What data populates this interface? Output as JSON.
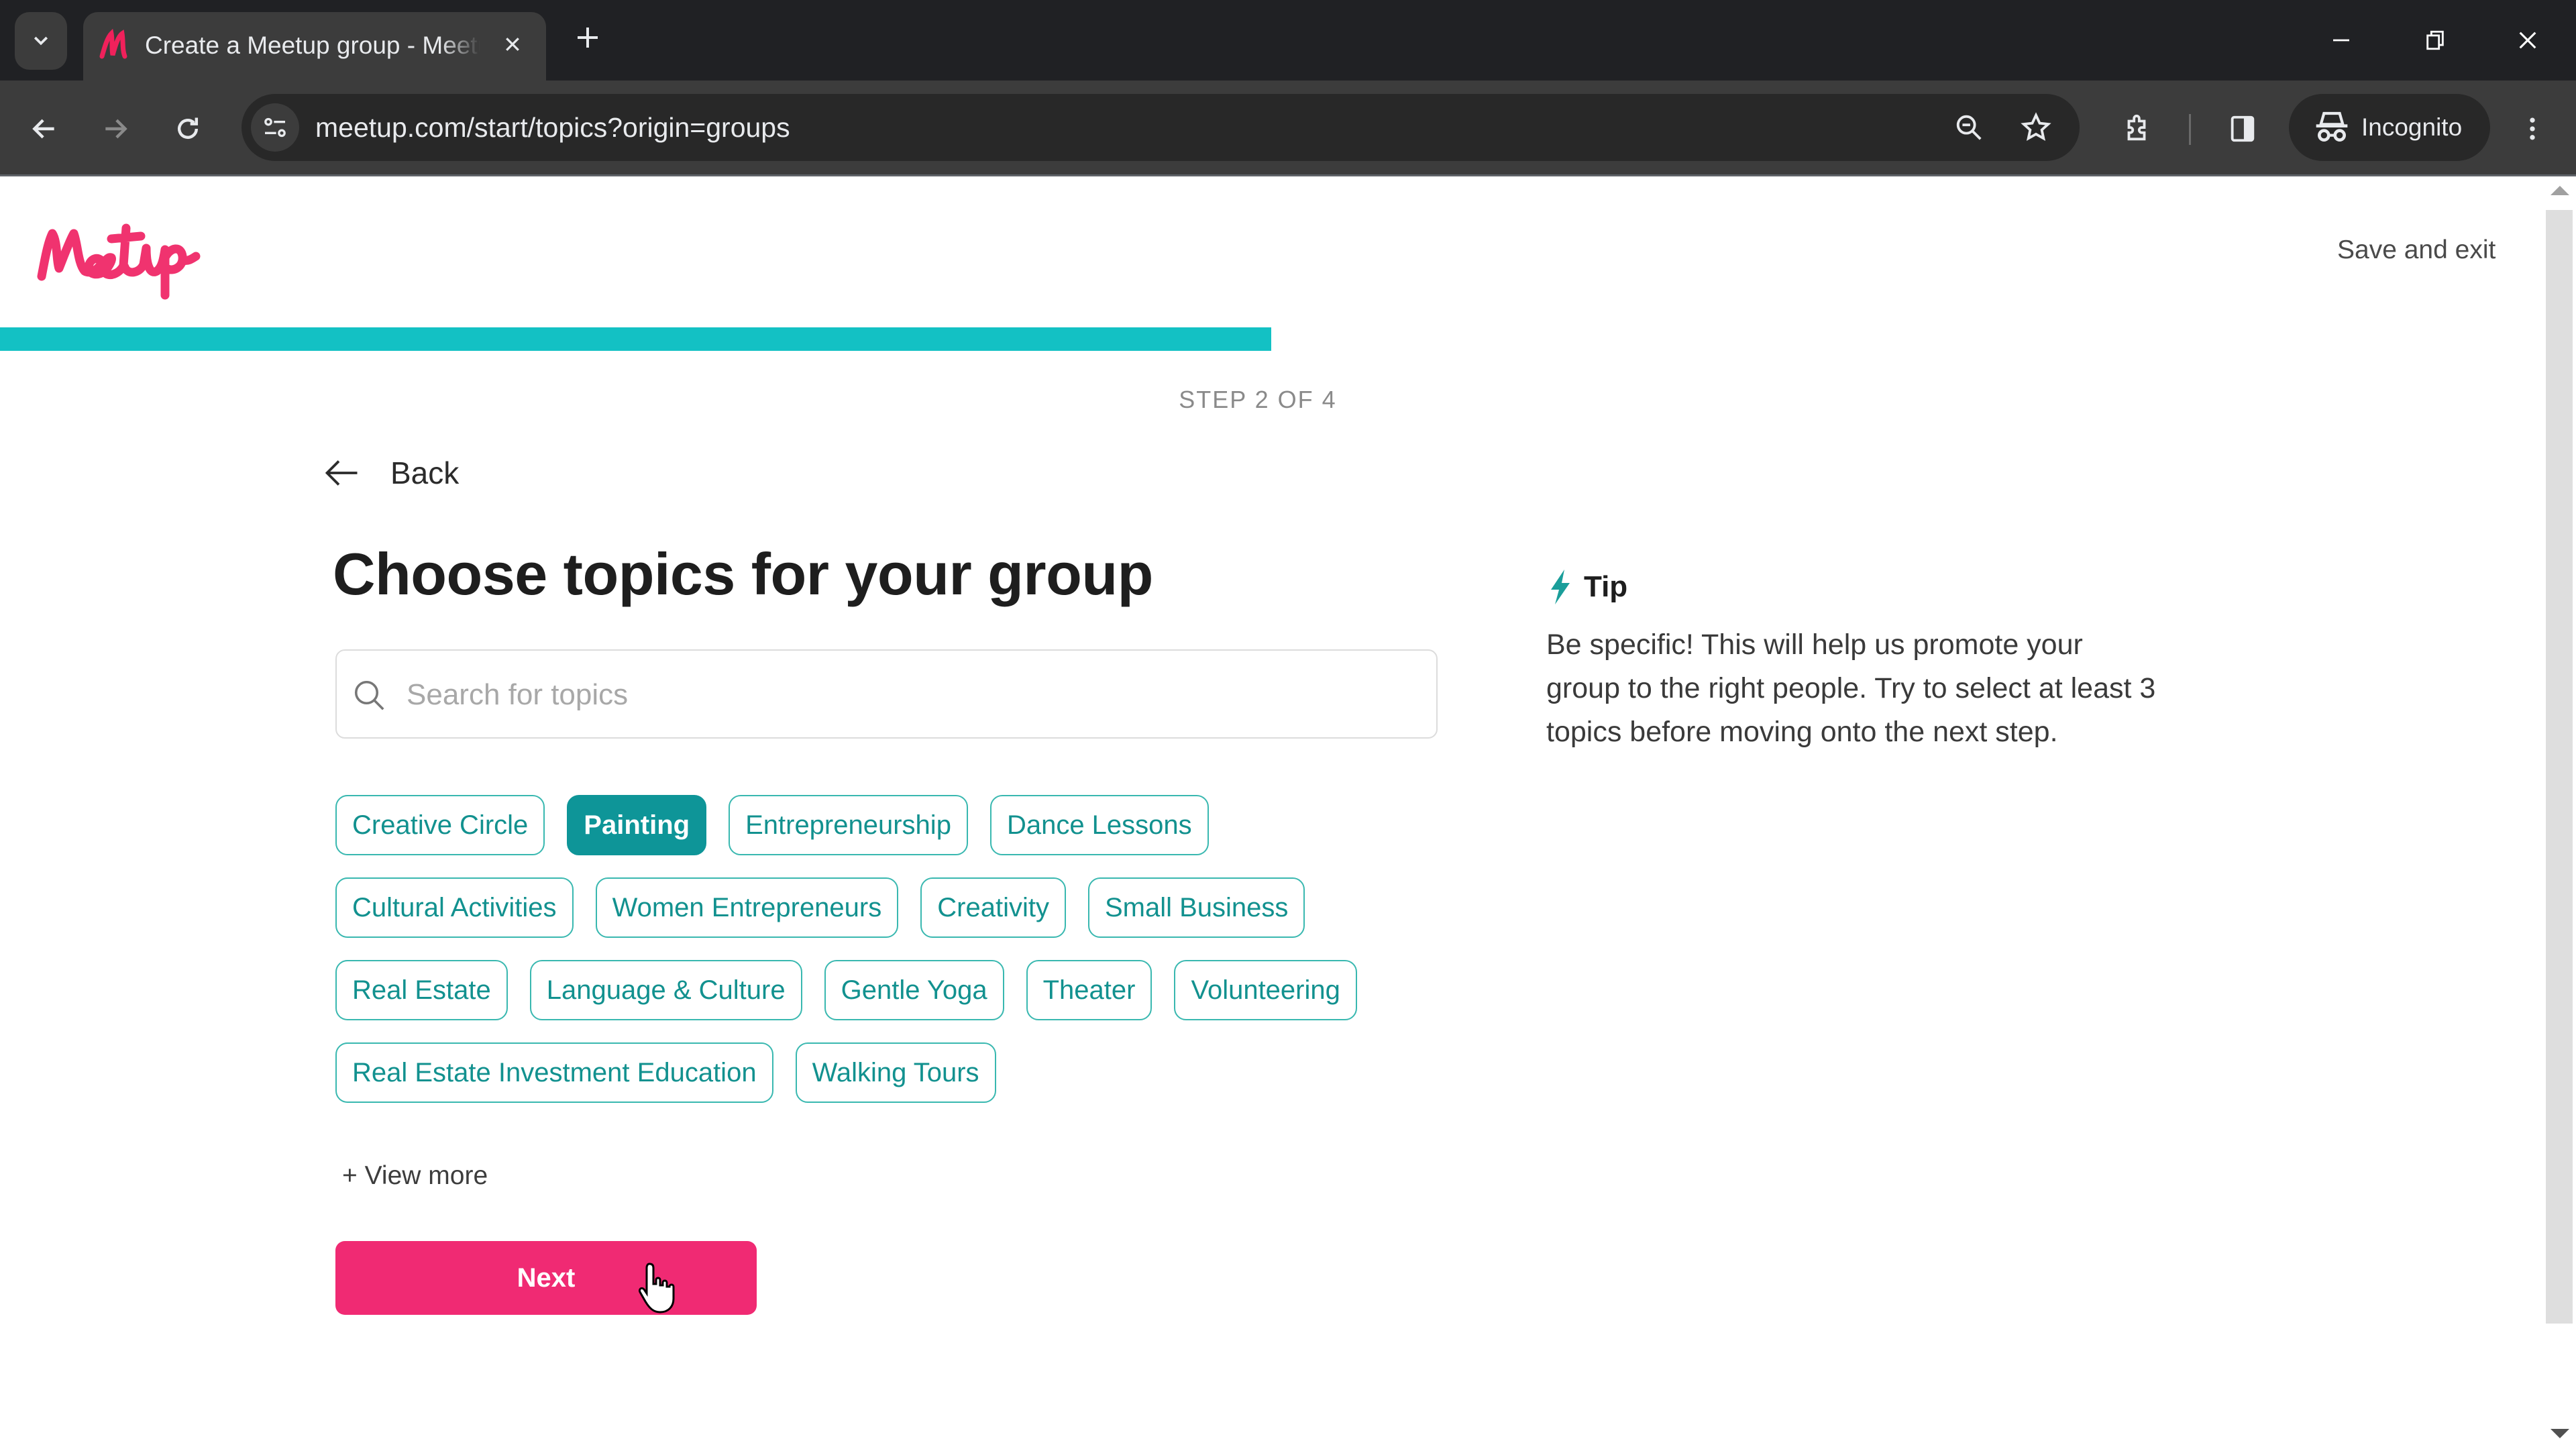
{
  "browser": {
    "tab_title": "Create a Meetup group - Meetup",
    "tab_favicon": "meetup-favicon",
    "url": "meetup.com/start/topics?origin=groups",
    "incognito_label": "Incognito",
    "icons": {
      "tab_search": "chevron-down-icon",
      "close_tab": "close-icon",
      "new_tab": "plus-icon",
      "minimize": "minimize-icon",
      "restore": "restore-icon",
      "close_window": "close-icon",
      "back": "arrow-left-icon",
      "forward": "arrow-right-icon",
      "reload": "reload-icon",
      "site_info": "tune-icon",
      "zoom": "zoom-out-icon",
      "bookmark": "star-icon",
      "extensions": "puzzle-icon",
      "side_panel": "side-panel-icon",
      "incognito": "incognito-icon",
      "menu": "kebab-menu-icon"
    }
  },
  "header": {
    "logo_text": "Meetup",
    "save_exit_label": "Save and exit",
    "brand_color": "#f02a73"
  },
  "progress": {
    "current_step": 2,
    "total_steps": 4,
    "fraction": 0.5,
    "step_label": "STEP 2 OF 4",
    "color": "#13c1c4"
  },
  "main": {
    "back_label": "Back",
    "title": "Choose topics for your group",
    "search": {
      "placeholder": "Search for topics",
      "value": ""
    },
    "topic_rows": [
      [
        {
          "label": "Creative Circle",
          "selected": false
        },
        {
          "label": "Painting",
          "selected": true
        },
        {
          "label": "Entrepreneurship",
          "selected": false
        },
        {
          "label": "Dance Lessons",
          "selected": false
        }
      ],
      [
        {
          "label": "Cultural Activities",
          "selected": false
        },
        {
          "label": "Women Entrepreneurs",
          "selected": false
        },
        {
          "label": "Creativity",
          "selected": false
        },
        {
          "label": "Small Business",
          "selected": false
        }
      ],
      [
        {
          "label": "Real Estate",
          "selected": false
        },
        {
          "label": "Language & Culture",
          "selected": false
        },
        {
          "label": "Gentle Yoga",
          "selected": false
        },
        {
          "label": "Theater",
          "selected": false
        },
        {
          "label": "Volunteering",
          "selected": false
        }
      ],
      [
        {
          "label": "Real Estate Investment Education",
          "selected": false
        },
        {
          "label": "Walking Tours",
          "selected": false
        }
      ]
    ],
    "view_more_label": "+ View more",
    "next_label": "Next",
    "chip_color": "#12918f",
    "chip_selected_color": "#0e9598"
  },
  "tip": {
    "icon": "lightning-bolt-icon",
    "title": "Tip",
    "body": "Be specific! This will help us promote your group to the right people. Try to select at least 3 topics before moving onto the next step."
  }
}
